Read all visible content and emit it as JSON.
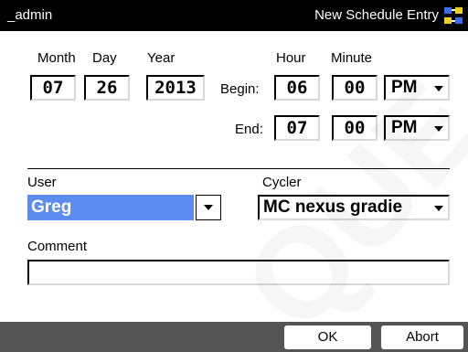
{
  "titlebar": {
    "user": "_admin",
    "title": "New Schedule Entry",
    "icon": "network-transfer-icon"
  },
  "date": {
    "month_label": "Month",
    "day_label": "Day",
    "year_label": "Year",
    "month": "07",
    "day": "26",
    "year": "2013"
  },
  "time": {
    "hour_label": "Hour",
    "minute_label": "Minute",
    "begin_label": "Begin:",
    "end_label": "End:",
    "begin_hour": "06",
    "begin_minute": "00",
    "begin_ampm": "PM",
    "end_hour": "07",
    "end_minute": "00",
    "end_ampm": "PM"
  },
  "user": {
    "label": "User",
    "value": "Greg"
  },
  "cycler": {
    "label": "Cycler",
    "value": "MC nexus gradie"
  },
  "comment": {
    "label": "Comment",
    "value": ""
  },
  "buttons": {
    "ok": "OK",
    "abort": "Abort"
  },
  "watermark": "QUE",
  "colors": {
    "titlebar_bg": "#000000",
    "bottombar_bg": "#555555",
    "selection": "#5c8cf0"
  }
}
